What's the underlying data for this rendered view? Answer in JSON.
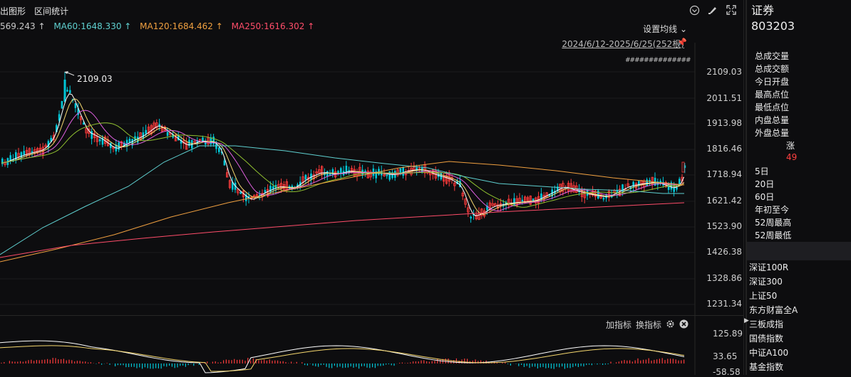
{
  "toolbar": {
    "draw_label": "出图形",
    "interval_stats_label": "区间统计"
  },
  "ma": [
    {
      "label": "569.243 ↑",
      "color": "#c9c9c9"
    },
    {
      "label": "MA60:1648.330 ↑",
      "color": "#5fd0d0"
    },
    {
      "label": "MA120:1684.462 ↑",
      "color": "#f0a040"
    },
    {
      "label": "MA250:1616.302 ↑",
      "color": "#ff4d6a"
    }
  ],
  "settings_label": "设置均线",
  "date_range": "2024/6/12-2025/6/25(252根)",
  "dots_text": "##############",
  "peak_label": "2109.03",
  "price_ticks": [
    "2109.03",
    "2011.51",
    "1913.98",
    "1816.46",
    "1718.94",
    "1621.42",
    "1523.90",
    "1426.38",
    "1328.86",
    "1231.34"
  ],
  "indicator": {
    "add_label": "加指标",
    "switch_label": "换指标",
    "ticks": [
      "125.89",
      "33.65",
      "-58.58"
    ]
  },
  "sidebar": {
    "title": "证券",
    "code": "803203",
    "stats": [
      "总成交量",
      "总成交额",
      "今日开盘",
      "最高点位",
      "最低点位",
      "内盘总量",
      "外盘总量"
    ],
    "zhang_label": "涨",
    "zhang_value": "49",
    "periods": [
      "5日",
      "20日",
      "60日",
      "年初至今",
      "52周最高",
      "52周最低"
    ],
    "indices": [
      "深证100R",
      "深证300",
      "上证50",
      "东方财富全A",
      "三板成指",
      "国债指数",
      "中证A100",
      "基金指数"
    ]
  },
  "colors": {
    "up": "#ff3b3b",
    "down": "#00c8d8",
    "ma5": "#ffffff",
    "ma10": "#f5d76e",
    "ma20": "#e060e0",
    "ma30": "#90c030",
    "ma60": "#5fd0d0",
    "ma120": "#f0a040",
    "ma250": "#ff4d6a"
  }
}
